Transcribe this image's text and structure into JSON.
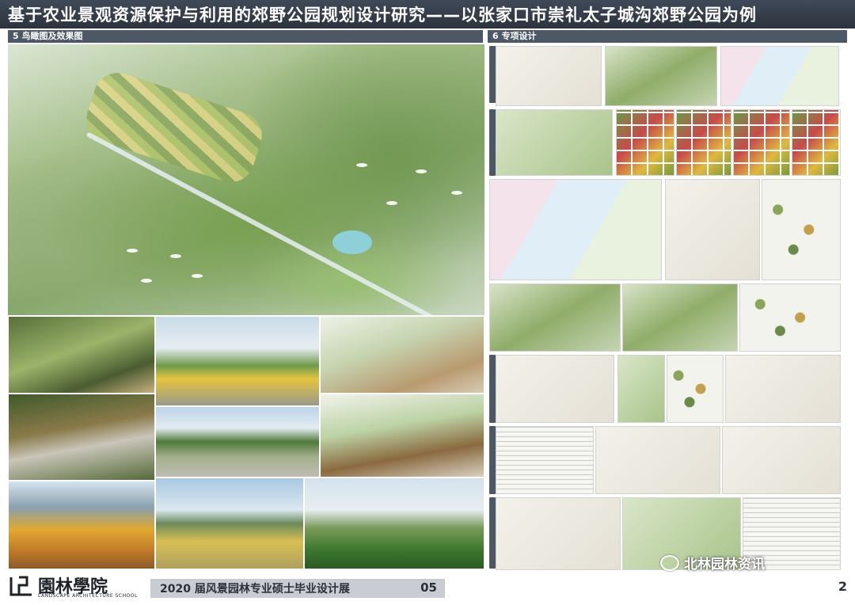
{
  "header": {
    "title": "基于农业景观资源保护与利用的郊野公园规划设计研究——以张家口市崇礼太子城沟郊野公园为例"
  },
  "sections": {
    "left_heading": "5 鸟瞰图及效果图",
    "right_heading": "6 专项设计"
  },
  "footer": {
    "school_name": "園林學院",
    "school_name_en": "LANDSCAPE ARCHITECTURE SCHOOL",
    "exhibition": "2020 届风景园林专业硕士毕业设计展",
    "code": "05",
    "page_number": "2"
  },
  "watermark": {
    "text": "北林园林资讯"
  }
}
